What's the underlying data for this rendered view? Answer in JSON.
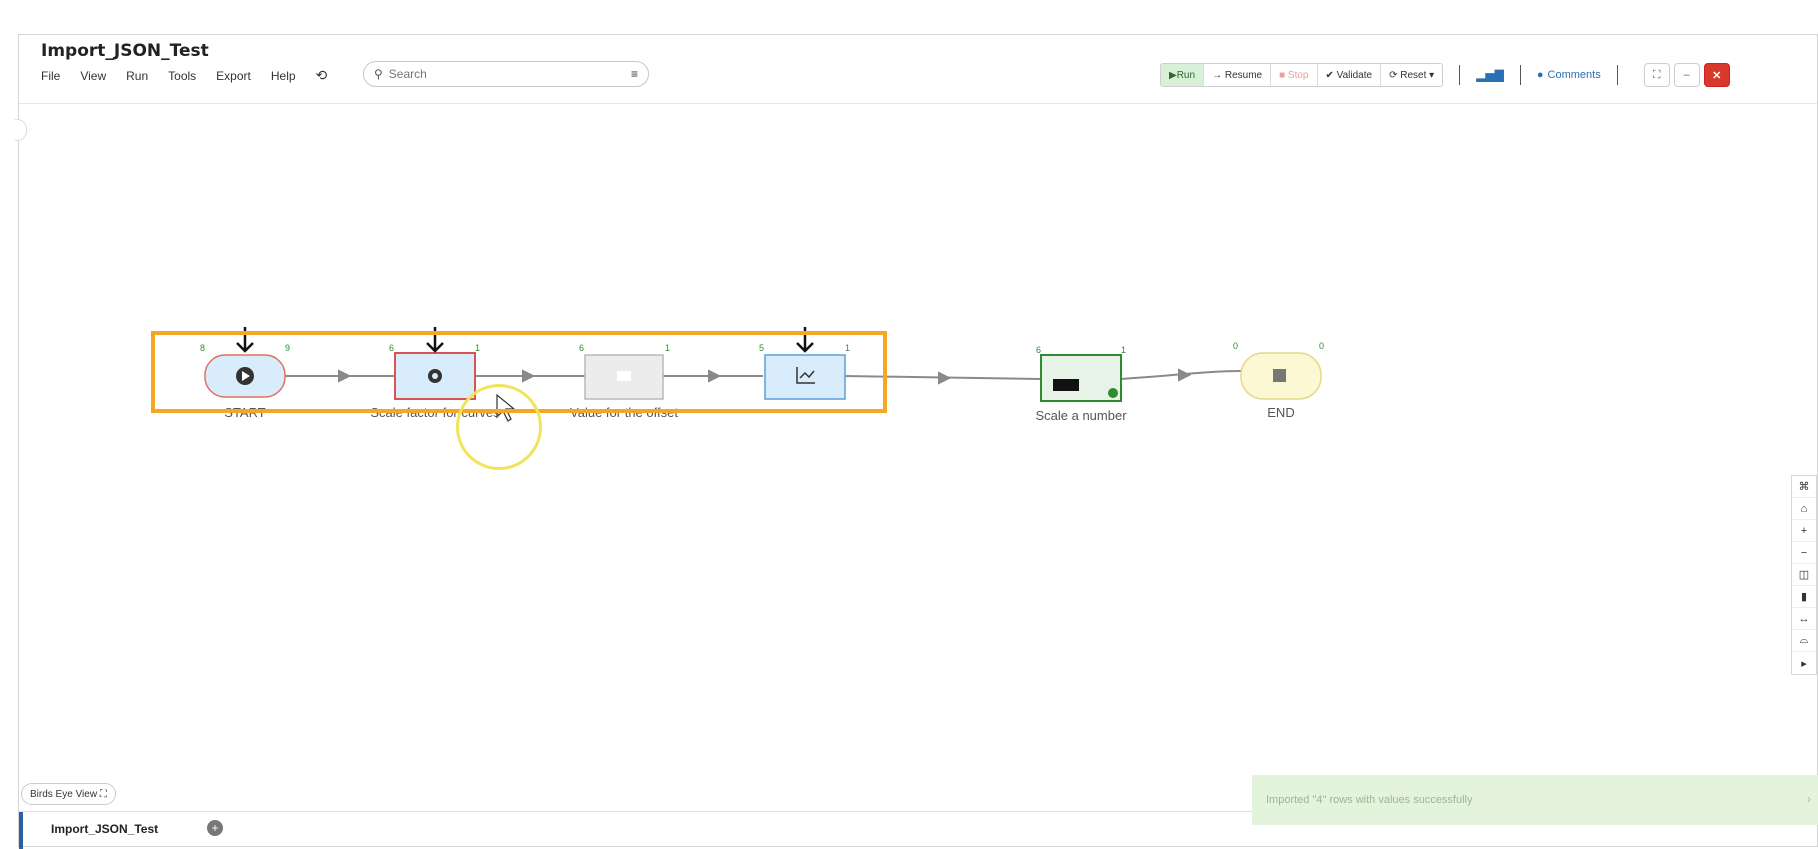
{
  "app": {
    "title": "Import_JSON_Test"
  },
  "menu": {
    "items": [
      "File",
      "View",
      "Run",
      "Tools",
      "Export",
      "Help"
    ],
    "history_icon": "history-icon"
  },
  "search": {
    "placeholder": "Search",
    "filter_icon": "filter-icon"
  },
  "toolbar": {
    "run": "Run",
    "resume": "Resume",
    "stop": "Stop",
    "validate": "Validate",
    "reset": "Reset",
    "comments": "Comments",
    "colors": {
      "run_bg": "#d8f0d8",
      "close": "#d9392b",
      "link": "#2b6fb5"
    }
  },
  "canvas": {
    "nodes": [
      {
        "id": "start",
        "label": "START",
        "port_in": "8",
        "port_out": "9",
        "shape": "rounded",
        "border": "#e07060",
        "fill": "#d9ecfb",
        "icon": "play-circle-icon"
      },
      {
        "id": "scale-factor",
        "label": "Scale factor for curves",
        "port_in": "6",
        "port_out": "1",
        "shape": "rect",
        "border": "#d9534f",
        "fill": "#d9ecfb",
        "icon": "gear-icon"
      },
      {
        "id": "value-offset",
        "label": "Value for the offset",
        "port_in": "6",
        "port_out": "1",
        "shape": "rect",
        "border": "#b8b8b8",
        "fill": "#ececec",
        "icon": "pencil-icon"
      },
      {
        "id": "chart-node",
        "label": "",
        "port_in": "5",
        "port_out": "1",
        "shape": "rect",
        "border": "#5aa0d8",
        "fill": "#d9ecfb",
        "icon": "line-chart-icon"
      },
      {
        "id": "scale-number",
        "label": "Scale a number",
        "port_in": "6",
        "port_out": "1",
        "shape": "rect",
        "border": "#2e8b2e",
        "fill": "#e6f3e6",
        "icon": "display-icon"
      },
      {
        "id": "end",
        "label": "END",
        "port_in": "0",
        "port_out": "0",
        "shape": "rounded",
        "border": "#e6d98a",
        "fill": "#fdf8d4",
        "icon": "stop-square-icon"
      }
    ]
  },
  "bottom": {
    "birds_eye": "Birds Eye View",
    "tab_label": "Import_JSON_Test"
  },
  "toast": {
    "message": "Imported \"4\" rows with values successfully"
  }
}
